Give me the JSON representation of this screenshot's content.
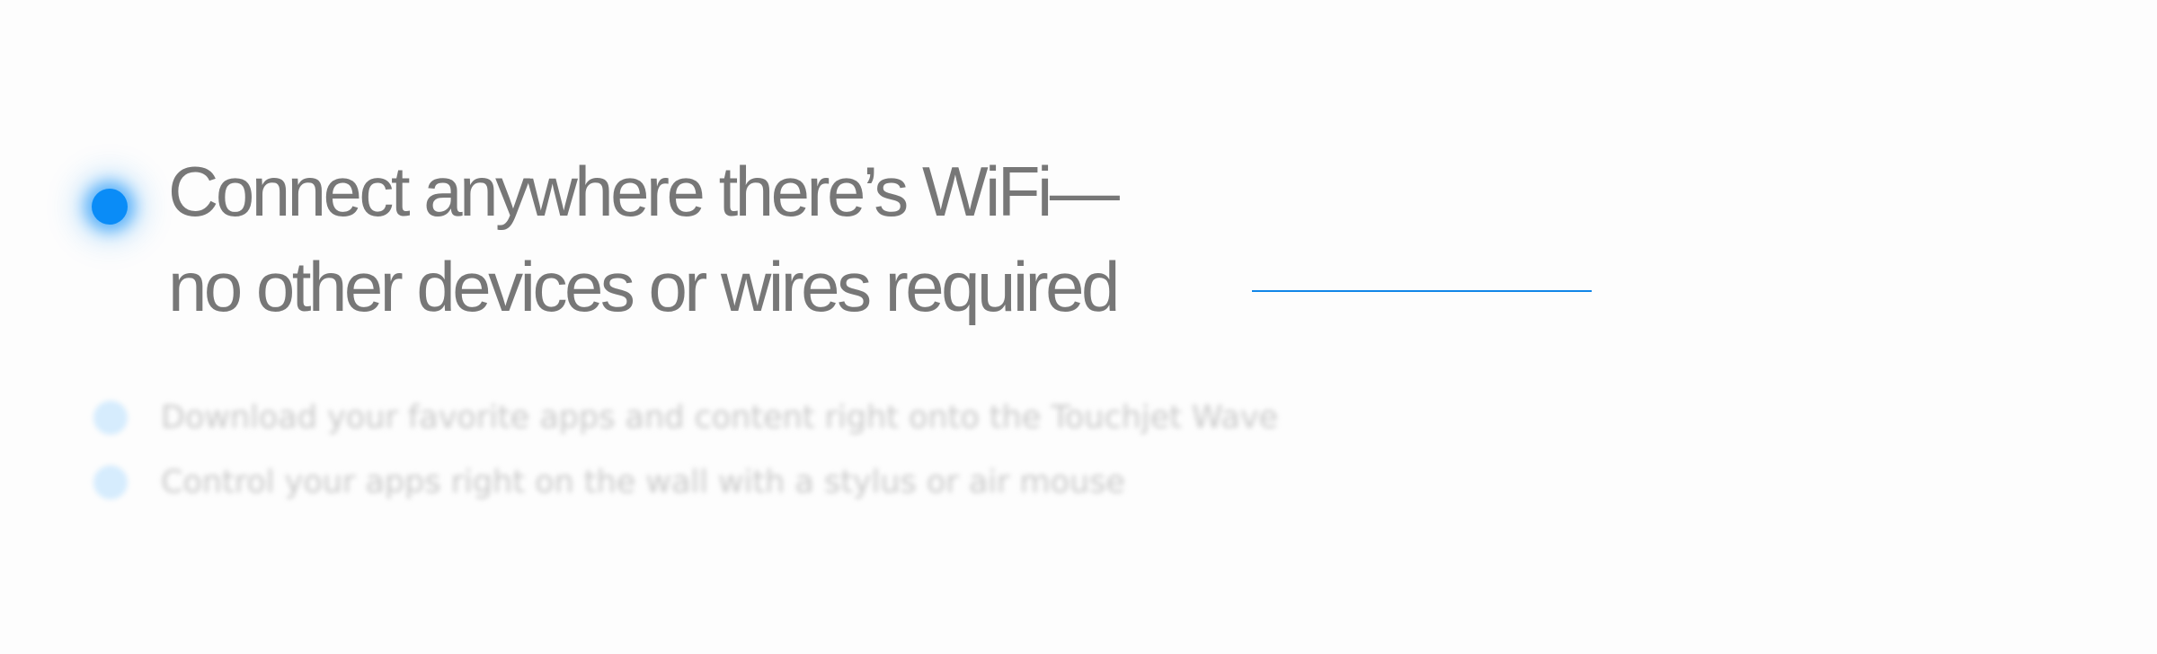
{
  "feature": {
    "headline_line1": "Connect anywhere there’s WiFi—",
    "headline_line2": "no other devices or wires required",
    "bullet_icon": "glowing-dot-icon",
    "accent_color": "#0a8cf7"
  },
  "other_features": [
    {
      "label": "Download your favorite apps and content right onto the Touchjet Wave",
      "icon": "dot-icon"
    },
    {
      "label": "Control your apps right on the wall with a stylus or air mouse",
      "icon": "dot-icon"
    }
  ],
  "colors": {
    "background": "#fdfdfd",
    "headline_text": "#777777",
    "muted_text": "#c9c9c9",
    "accent_line": "#1186e8",
    "muted_dot": "#d6ecfd"
  }
}
